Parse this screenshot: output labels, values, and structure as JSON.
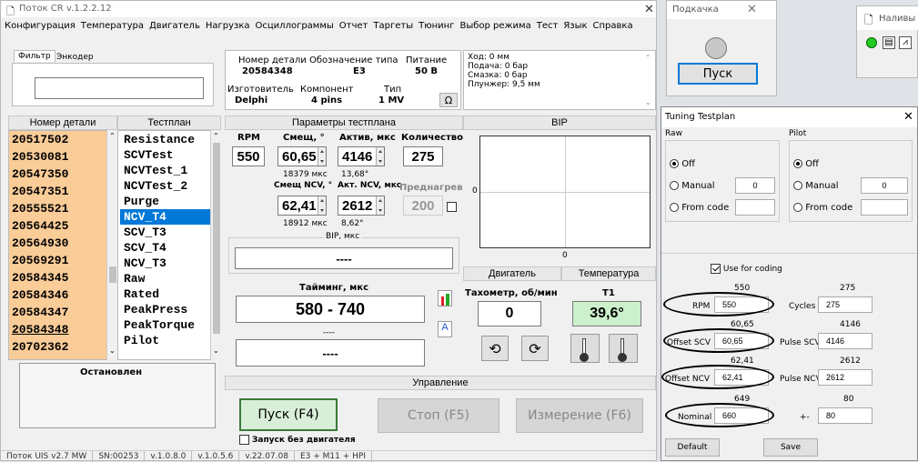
{
  "main": {
    "title": "Поток CR v.1.2.2.12",
    "menu": [
      "Конфигурация",
      "Температура",
      "Двигатель",
      "Нагрузка",
      "Осциллограммы",
      "Отчет",
      "Таргеты",
      "Тюнинг",
      "Выбор режима",
      "Тест",
      "Язык",
      "Справка"
    ],
    "tabs": [
      "Фильтр",
      "Энкодер"
    ],
    "info": {
      "part_label": "Номер детали",
      "part": "20584348",
      "type_label": "Обозначение типа",
      "type": "E3",
      "power_label": "Питание",
      "power": "50 В",
      "maker_label": "Изготовитель",
      "maker": "Delphi",
      "comp_label": "Компонент",
      "comp": "4 pins",
      "kind_label": "Тип",
      "kind": "1 MV",
      "omega": "Ω"
    },
    "status_lines": [
      "Ход: 0 мм",
      "Подача: 0 бар",
      "Смазка: 0 бар",
      "Плунжер: 9,5 мм"
    ],
    "list_headers": {
      "part": "Номер детали",
      "plan": "Тестплан"
    },
    "parts": [
      "20517502",
      "20530081",
      "20547350",
      "20547351",
      "20555521",
      "20564425",
      "20564930",
      "20569291",
      "20584345",
      "20584346",
      "20584347",
      "20584348",
      "20702362"
    ],
    "plans": [
      "Resistance",
      "SCVTest",
      "NCVTest_1",
      "NCVTest_2",
      "Purge",
      "NCV_T4",
      "SCV_T3",
      "SCV_T4",
      "NCV_T3",
      "Raw",
      "Rated",
      "PeakPress",
      "PeakTorque",
      "Pilot"
    ],
    "params": {
      "title": "Параметры тестплана",
      "rpm_label": "RPM",
      "offset_label": "Смещ, °",
      "active_label": "Актив, мкс",
      "count_label": "Количество",
      "rpm": "550",
      "offset": "60,65",
      "active": "4146",
      "count": "275",
      "sub1": "18379 мкс",
      "sub2": "13,68°",
      "ncv_offset_label": "Смещ NCV, °",
      "ncv_active_label": "Акт. NCV, мкс",
      "preheat_label": "Преднагрев",
      "ncv_offset": "62,41",
      "ncv_active": "2612",
      "preheat": "200",
      "sub3": "18912 мкс",
      "sub4": "8,62°",
      "bip_label": "BIP, мкс",
      "bip": "----"
    },
    "bip_title": "BIP",
    "bip_axis0a": "0",
    "bip_axis0b": "0",
    "engine": "Двигатель",
    "temperature": "Температура",
    "timing": {
      "label": "Тайминг, мкс",
      "value": "580 - 740",
      "dash1": "----",
      "dash2": "----"
    },
    "tacho_label": "Тахометр, об/мин",
    "tacho": "0",
    "t1_label": "T1",
    "t1": "39,6°",
    "stopped": "Остановлен",
    "control": "Управление",
    "btn_start": "Пуск (F4)",
    "btn_stop": "Стоп (F5)",
    "btn_measure": "Измерение (F6)",
    "no_engine": "Запуск без двигателя",
    "statusbar": [
      "Поток UIS v2.7 MW",
      "SN:00253",
      "v.1.0.8.0",
      "v.1.0.5.6",
      "v.22.07.08",
      "E3 + M11 + HPI"
    ]
  },
  "pump": {
    "title": "Подкачка",
    "button": "Пуск"
  },
  "fill": {
    "title": "Наливы"
  },
  "tuning": {
    "title": "Tuning Testplan",
    "raw": "Raw",
    "pilot": "Pilot",
    "off": "Off",
    "manual": "Manual",
    "from_code": "From code",
    "raw_manual": "0",
    "pilot_manual": "0",
    "use_coding": "Use for coding",
    "rpm_label": "RPM",
    "rpm": "550",
    "rpm_top": "550",
    "cycles_label": "Cycles",
    "cycles": "275",
    "cycles_top": "275",
    "offscv_label": "Offset SCV",
    "offscv": "60,65",
    "offscv_top": "60,65",
    "pulsescv_label": "Pulse SCV",
    "pulsescv": "4146",
    "pulsescv_top": "4146",
    "offncv_label": "Offset NCV",
    "offncv": "62,41",
    "offncv_top": "62,41",
    "pulsencv_label": "Pulse NCV",
    "pulsencv": "2612",
    "pulsencv_top": "2612",
    "nominal_label": "Nominal",
    "nominal": "660",
    "nominal_top": "649",
    "pm_label": "+-",
    "pm": "80",
    "pm_top": "80",
    "default": "Default",
    "save": "Save"
  },
  "colors": {
    "part_bg": "#f9cc98",
    "selected": "#0078d7",
    "green": "#3c9e3c",
    "t1_bg": "#ccf0cc"
  }
}
